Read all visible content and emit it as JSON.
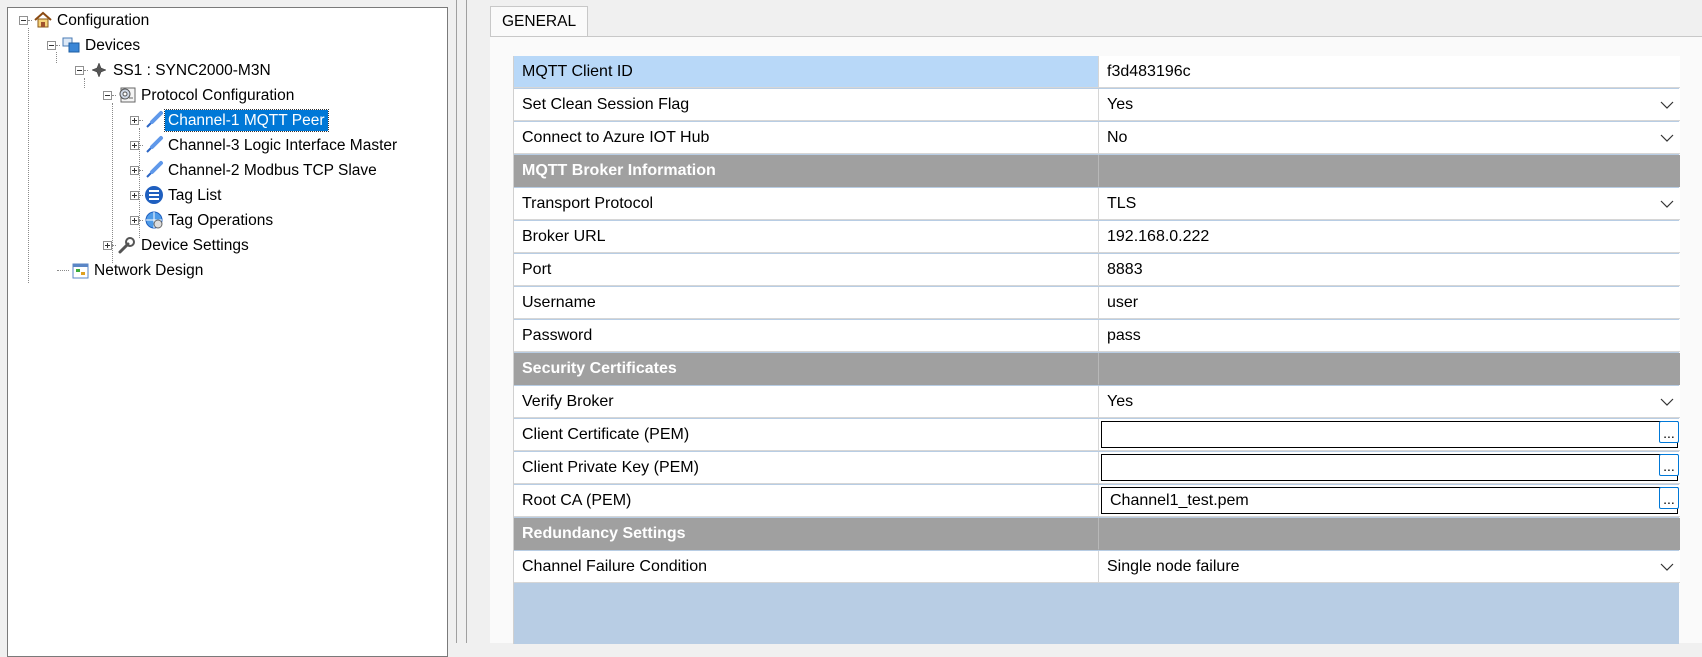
{
  "tree": {
    "configuration": "Configuration",
    "devices": "Devices",
    "device": "SS1 : SYNC2000-M3N",
    "protocol_configuration": "Protocol Configuration",
    "channel1": "Channel-1 MQTT Peer",
    "channel3": "Channel-3 Logic Interface Master",
    "channel2": "Channel-2 Modbus TCP Slave",
    "tag_list": "Tag List",
    "tag_operations": "Tag Operations",
    "device_settings": "Device Settings",
    "network_design": "Network Design"
  },
  "tab": {
    "label": "GENERAL"
  },
  "properties": {
    "client_id": {
      "name": "MQTT Client ID",
      "value": "f3d483196c"
    },
    "clean_session": {
      "name": "Set Clean Session Flag",
      "value": "Yes"
    },
    "azure": {
      "name": "Connect to Azure IOT Hub",
      "value": "No"
    },
    "cat_broker": "MQTT Broker Information",
    "transport": {
      "name": "Transport Protocol",
      "value": "TLS"
    },
    "broker_url": {
      "name": "Broker URL",
      "value": "192.168.0.222"
    },
    "port": {
      "name": "Port",
      "value": "8883"
    },
    "username": {
      "name": "Username",
      "value": "user"
    },
    "password": {
      "name": "Password",
      "value": "pass"
    },
    "cat_security": "Security Certificates",
    "verify_broker": {
      "name": "Verify Broker",
      "value": "Yes"
    },
    "client_cert": {
      "name": "Client Certificate (PEM)",
      "value": ""
    },
    "client_key": {
      "name": "Client Private Key (PEM)",
      "value": ""
    },
    "root_ca": {
      "name": "Root CA (PEM)",
      "value": "Channel1_test.pem"
    },
    "cat_redundancy": "Redundancy Settings",
    "failure": {
      "name": "Channel Failure Condition",
      "value": "Single node failure"
    }
  },
  "browse_label": "...",
  "colors": {
    "selection": "#0078d7",
    "category": "#a0a0a0",
    "grid_bg": "#b8cde4",
    "selected_row": "#b8d8f8"
  }
}
